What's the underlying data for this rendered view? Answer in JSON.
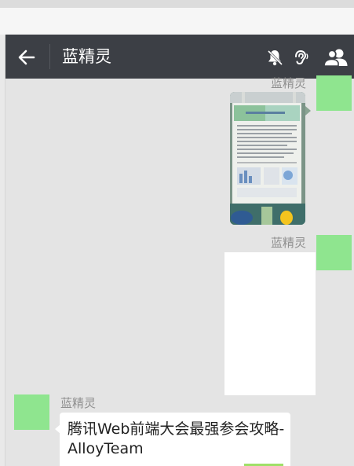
{
  "header": {
    "title": "蓝精灵",
    "back_icon": "arrow-left-icon",
    "mute_icon": "bell-off-icon",
    "ear_icon": "ear-icon",
    "members_icon": "people-icon"
  },
  "messages": [
    {
      "sender": "蓝精灵",
      "side": "right",
      "type": "image"
    },
    {
      "sender": "蓝精灵",
      "side": "right",
      "type": "image"
    },
    {
      "sender": "蓝精灵",
      "side": "left",
      "type": "link",
      "title": "腾讯Web前端大会最强参会攻略-AlloyTeam"
    }
  ],
  "colors": {
    "header_bg": "#3c3f45",
    "chat_bg": "#e4e4e4",
    "avatar": "#8fe58f"
  }
}
